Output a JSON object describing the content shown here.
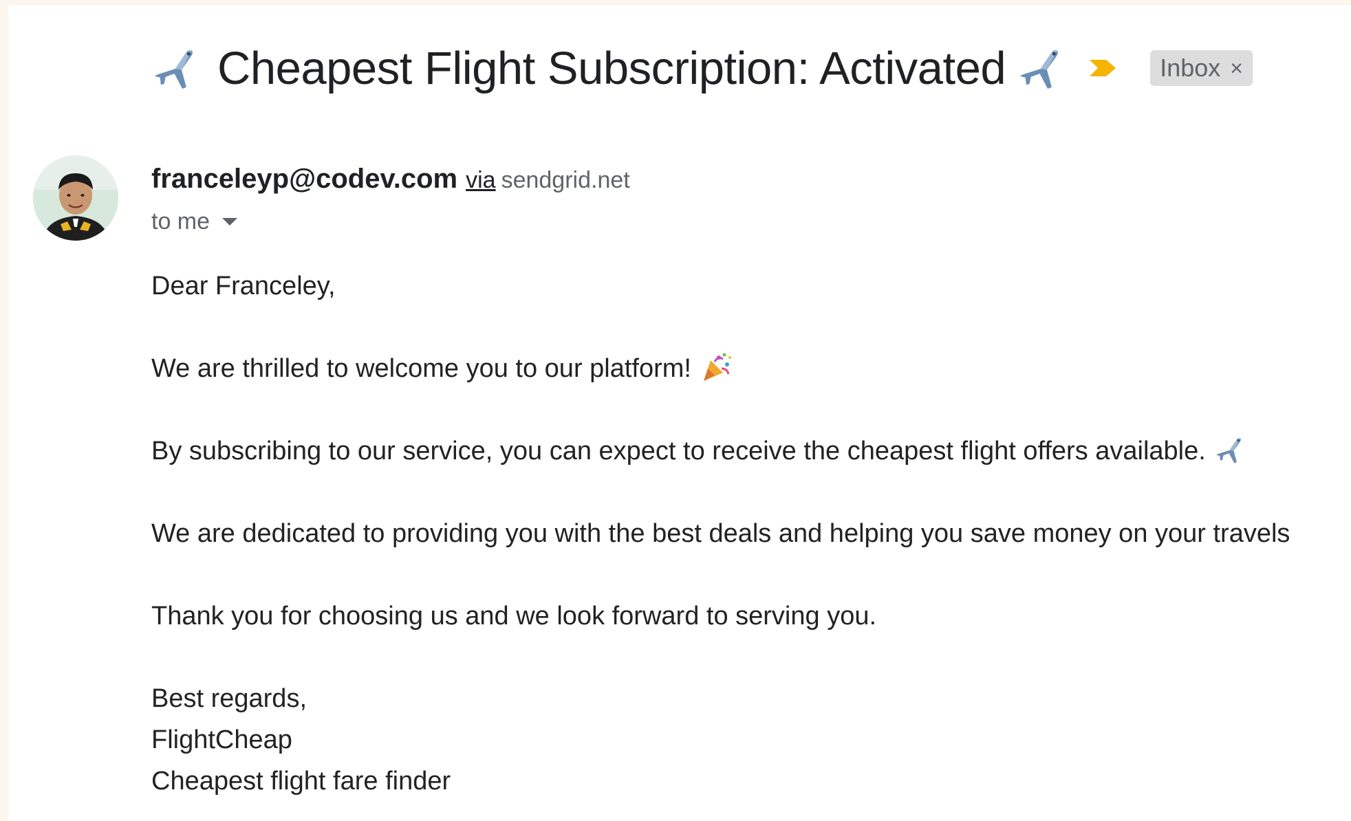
{
  "email": {
    "subject": "Cheapest Flight Subscription: Activated",
    "label_chip": {
      "text": "Inbox",
      "remove_glyph": "×"
    },
    "sender": {
      "email": "franceleyp@codev.com",
      "via_label": "via",
      "via_domain": "sendgrid.net"
    },
    "recipient_text": "to me",
    "body": {
      "greeting": "Dear Franceley,",
      "paragraph_1": "We are thrilled to welcome you to our platform!",
      "paragraph_2": "By subscribing to our service, you can expect to receive the cheapest flight offers available.",
      "paragraph_3": "We are dedicated to providing you with the best deals and helping you save money on your travels",
      "paragraph_4": "Thank you for choosing us and we look forward to serving you.",
      "signoff": "Best regards,",
      "signature_name": "FlightCheap",
      "signature_tagline": "Cheapest flight fare finder"
    },
    "icons": {
      "subject_prefix": "airplane-icon",
      "subject_suffix": "airplane-icon",
      "importance": "importance-marker-icon",
      "paragraph_1_emoji": "party-popper-icon",
      "paragraph_2_emoji": "airplane-icon",
      "recipient_details": "caret-down-icon"
    },
    "colors": {
      "importance_marker": "#f4b400",
      "chip_background": "#dddddd",
      "airplane_body": "#6a8fb5",
      "page_margin": "#fdf6ef"
    }
  }
}
